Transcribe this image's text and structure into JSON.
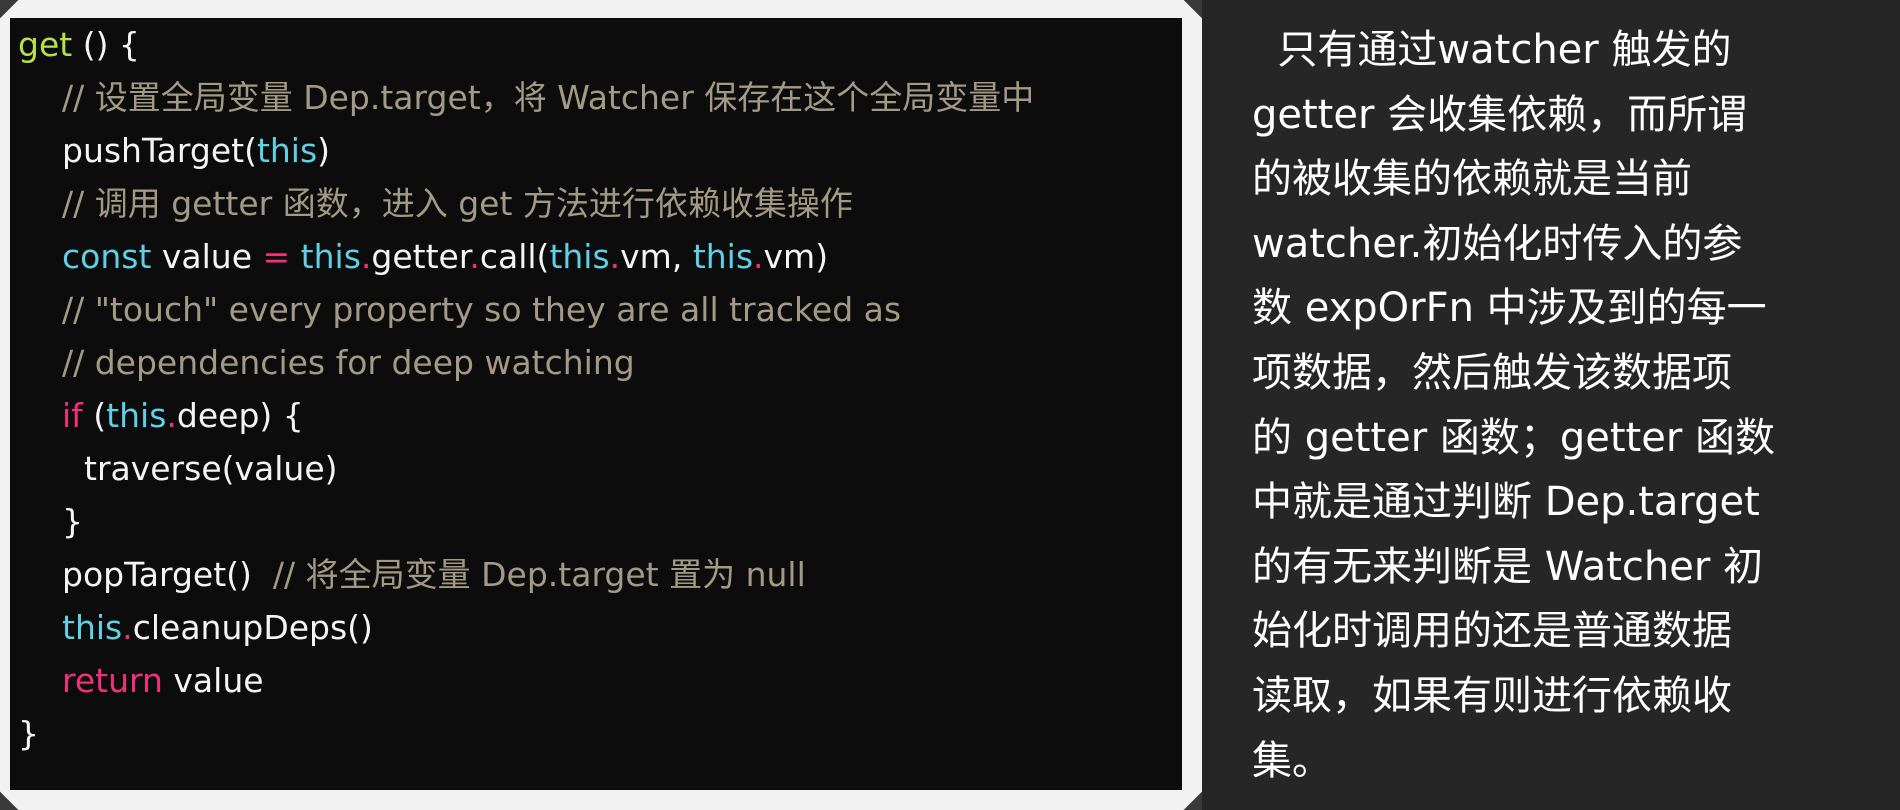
{
  "code": {
    "lines": [
      {
        "indent": 0,
        "tokens": [
          {
            "t": "get",
            "c": "get"
          },
          {
            "t": " () {",
            "c": "plain"
          }
        ]
      },
      {
        "indent": 2,
        "tokens": [
          {
            "t": "// 设置全局变量 Dep.target，将 Watcher 保存在这个全局变量中",
            "c": "comment"
          }
        ]
      },
      {
        "indent": 2,
        "tokens": [
          {
            "t": "pushTarget(",
            "c": "plain"
          },
          {
            "t": "this",
            "c": "this"
          },
          {
            "t": ")",
            "c": "plain"
          }
        ]
      },
      {
        "indent": 2,
        "tokens": [
          {
            "t": "// 调用 getter 函数，进入 get 方法进行依赖收集操作",
            "c": "comment"
          }
        ]
      },
      {
        "indent": 2,
        "tokens": [
          {
            "t": "const",
            "c": "this"
          },
          {
            "t": " value ",
            "c": "plain"
          },
          {
            "t": "=",
            "c": "keyword"
          },
          {
            "t": " ",
            "c": "plain"
          },
          {
            "t": "this",
            "c": "this"
          },
          {
            "t": ".",
            "c": "keyword"
          },
          {
            "t": "getter",
            "c": "plain"
          },
          {
            "t": ".",
            "c": "keyword"
          },
          {
            "t": "call(",
            "c": "plain"
          },
          {
            "t": "this",
            "c": "this"
          },
          {
            "t": ".",
            "c": "keyword"
          },
          {
            "t": "vm, ",
            "c": "plain"
          },
          {
            "t": "this",
            "c": "this"
          },
          {
            "t": ".",
            "c": "keyword"
          },
          {
            "t": "vm)",
            "c": "plain"
          }
        ]
      },
      {
        "indent": 2,
        "tokens": [
          {
            "t": "// \"touch\" every property so they are all tracked as",
            "c": "comment"
          }
        ]
      },
      {
        "indent": 2,
        "tokens": [
          {
            "t": "// dependencies for deep watching",
            "c": "comment"
          }
        ]
      },
      {
        "indent": 2,
        "tokens": [
          {
            "t": "if",
            "c": "keyword"
          },
          {
            "t": " (",
            "c": "plain"
          },
          {
            "t": "this",
            "c": "this"
          },
          {
            "t": ".",
            "c": "keyword"
          },
          {
            "t": "deep) {",
            "c": "plain"
          }
        ]
      },
      {
        "indent": 3,
        "tokens": [
          {
            "t": "traverse(value)",
            "c": "plain"
          }
        ]
      },
      {
        "indent": 2,
        "tokens": [
          {
            "t": "}",
            "c": "plain"
          }
        ]
      },
      {
        "indent": 2,
        "tokens": [
          {
            "t": "popTarget()  ",
            "c": "plain"
          },
          {
            "t": "// 将全局变量 Dep.target 置为 null",
            "c": "comment"
          }
        ]
      },
      {
        "indent": 2,
        "tokens": [
          {
            "t": "this",
            "c": "this"
          },
          {
            "t": ".",
            "c": "keyword"
          },
          {
            "t": "cleanupDeps()",
            "c": "plain"
          }
        ]
      },
      {
        "indent": 2,
        "tokens": [
          {
            "t": "return",
            "c": "keyword"
          },
          {
            "t": " value",
            "c": "plain"
          }
        ]
      },
      {
        "indent": 0,
        "tokens": [
          {
            "t": "}",
            "c": "plain"
          }
        ]
      }
    ]
  },
  "explanation": {
    "lines": [
      "  只有通过watcher 触发的",
      "getter 会收集依赖，而所谓",
      "的被收集的依赖就是当前",
      "watcher.初始化时传入的参",
      "数 expOrFn 中涉及到的每一",
      "项数据，然后触发该数据项",
      "的 getter 函数；getter 函数",
      "中就是通过判断 Dep.target",
      "的有无来判断是 Watcher 初",
      "始化时调用的还是普通数据",
      "读取，如果有则进行依赖收",
      "集。"
    ]
  },
  "colors": {
    "code_background": "#0c0c0c",
    "frame": "#f2f2f2",
    "text_panel_background": "#262626",
    "keyword": "#f0307a",
    "this_keyword": "#5fd0e6",
    "comment": "#a39a86",
    "get_keyword": "#b8e04a",
    "plain": "#f4f4f4"
  }
}
